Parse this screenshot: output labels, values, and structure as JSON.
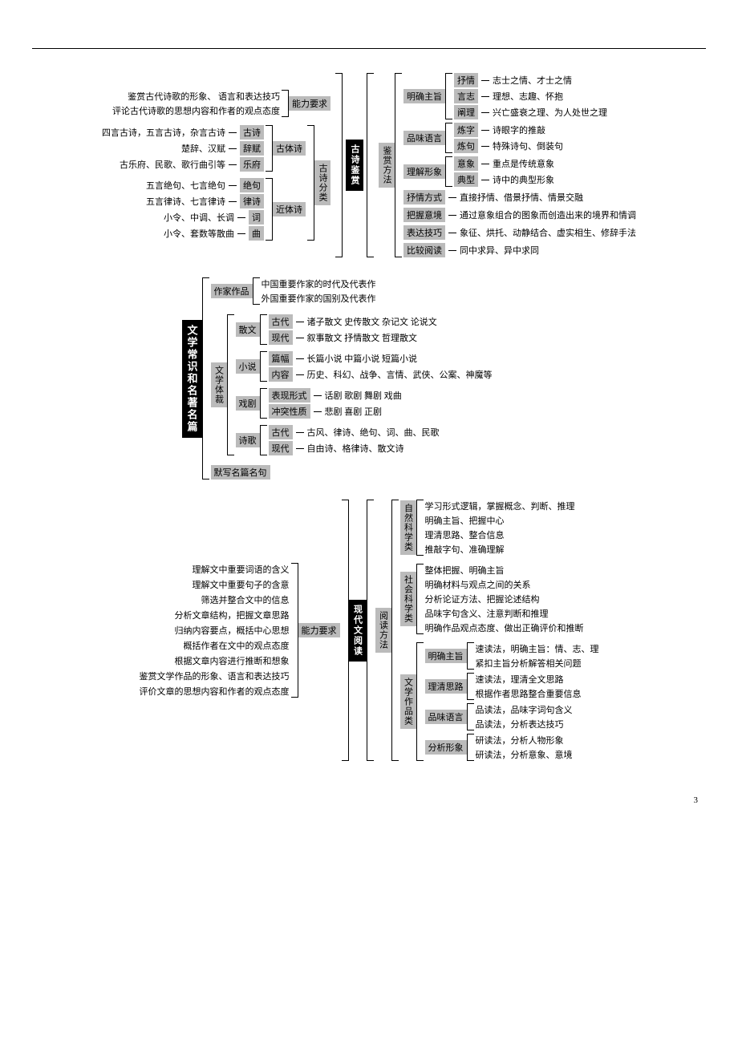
{
  "page_number": "3",
  "section1": {
    "center_title": "古诗鉴赏",
    "left_upper_badge": "能力要求",
    "left_upper": [
      "鉴赏古代诗歌的形象、 语言和表达技巧",
      "评论古代诗歌的思想内容和作者的观点态度"
    ],
    "left_mid_vbadge": "古诗分类",
    "left_mid_groups": [
      {
        "badge": "古体诗",
        "items": [
          {
            "lab": "古诗",
            "desc": "四言古诗，五言古诗，杂言古诗"
          },
          {
            "lab": "辞赋",
            "desc": "楚辞、汉赋"
          },
          {
            "lab": "乐府",
            "desc": "古乐府、民歌、歌行曲引等"
          }
        ]
      },
      {
        "badge": "近体诗",
        "items": [
          {
            "lab": "绝句",
            "desc": "五言绝句、七言绝句"
          },
          {
            "lab": "律诗",
            "desc": "五言律诗、七言律诗"
          },
          {
            "lab": "词",
            "desc": "小令、中调、长调"
          },
          {
            "lab": "曲",
            "desc": "小令、套数等散曲"
          }
        ]
      }
    ],
    "right_vbadge": "鉴赏方法",
    "right_groups": [
      {
        "badge": "明确主旨",
        "items": [
          {
            "lab": "抒情",
            "desc": "志士之情、才士之情"
          },
          {
            "lab": "言志",
            "desc": "理想、志趣、怀抱"
          },
          {
            "lab": "阐理",
            "desc": "兴亡盛衰之理、为人处世之理"
          }
        ]
      },
      {
        "badge": "品味语言",
        "items": [
          {
            "lab": "炼字",
            "desc": "诗眼字的推敲"
          },
          {
            "lab": "炼句",
            "desc": "特殊诗句、倒装句"
          }
        ]
      },
      {
        "badge": "理解形象",
        "items": [
          {
            "lab": "意象",
            "desc": "重点是传统意象"
          },
          {
            "lab": "典型",
            "desc": "诗中的典型形象"
          }
        ]
      },
      {
        "badge": "抒情方式",
        "plain": "直接抒情、借景抒情、情景交融"
      },
      {
        "badge": "把握意境",
        "plain": "通过意象组合的图象而创造出来的境界和情调"
      },
      {
        "badge": "表达技巧",
        "plain": "象征、烘托、动静结合、虚实相生、修辞手法"
      },
      {
        "badge": "比较阅读",
        "plain": "同中求异、异中求同"
      }
    ]
  },
  "section2": {
    "center_title": "文学常识和名著名篇",
    "top_badge": "作家作品",
    "top_items": [
      "中国重要作家的时代及代表作",
      "外国重要作家的国别及代表作"
    ],
    "mid_vbadge": "文学体裁",
    "mid_groups": [
      {
        "badge": "散文",
        "items": [
          {
            "lab": "古代",
            "desc": "诸子散文  史传散文  杂记文  论说文"
          },
          {
            "lab": "现代",
            "desc": "叙事散文  抒情散文  哲理散文"
          }
        ]
      },
      {
        "badge": "小说",
        "items": [
          {
            "lab": "篇幅",
            "desc": "长篇小说  中篇小说  短篇小说"
          },
          {
            "lab": "内容",
            "desc": "历史、科幻、战争、言情、武侠、公案、神魔等"
          }
        ]
      },
      {
        "badge": "戏剧",
        "items": [
          {
            "lab": "表现形式",
            "desc": "话剧  歌剧  舞剧  戏曲"
          },
          {
            "lab": "冲突性质",
            "desc": "悲剧  喜剧  正剧"
          }
        ]
      },
      {
        "badge": "诗歌",
        "items": [
          {
            "lab": "古代",
            "desc": "古风、律诗、绝句、词、曲、民歌"
          },
          {
            "lab": "现代",
            "desc": "自由诗、格律诗、散文诗"
          }
        ]
      }
    ],
    "bottom_badge": "默写名篇名句"
  },
  "section3": {
    "center_title": "现代文阅读",
    "left_badge": "能力要求",
    "left_items": [
      "理解文中重要词语的含义",
      "理解文中重要句子的含意",
      "筛选并整合文中的信息",
      "分析文章结构，把握文章思路",
      "归纳内容要点，概括中心思想",
      "概括作者在文中的观点态度",
      "根据文章内容进行推断和想象",
      "鉴赏文学作品的形象、语言和表达技巧",
      "评价文章的思想内容和作者的观点态度"
    ],
    "right_vbadge": "阅读方法",
    "right_groups": [
      {
        "vbadge": "自然科学类",
        "items": [
          "学习形式逻辑，掌握概念、判断、推理",
          "明确主旨、把握中心",
          "理清思路、整合信息",
          "推敲字句、准确理解"
        ]
      },
      {
        "vbadge": "社会科学类",
        "items": [
          "整体把握、明确主旨",
          "明确材料与观点之间的关系",
          "分析论证方法、把握论述结构",
          "品味字句含义、注意判断和推理",
          "明确作品观点态度、做出正确评价和推断"
        ]
      },
      {
        "vbadge": "文学作品类",
        "sub": [
          {
            "badge": "明确主旨",
            "items": [
              "速读法，明确主旨：情、志、理",
              "紧扣主旨分析解答相关问题"
            ]
          },
          {
            "badge": "理清思路",
            "items": [
              "速读法，理清全文思路",
              "根据作者思路整合重要信息"
            ]
          },
          {
            "badge": "品味语言",
            "items": [
              "品读法，品味字词句含义",
              "品读法，分析表达技巧"
            ]
          },
          {
            "badge": "分析形象",
            "items": [
              "研读法，分析人物形象",
              "研读法，分析意象、意境"
            ]
          }
        ]
      }
    ]
  }
}
